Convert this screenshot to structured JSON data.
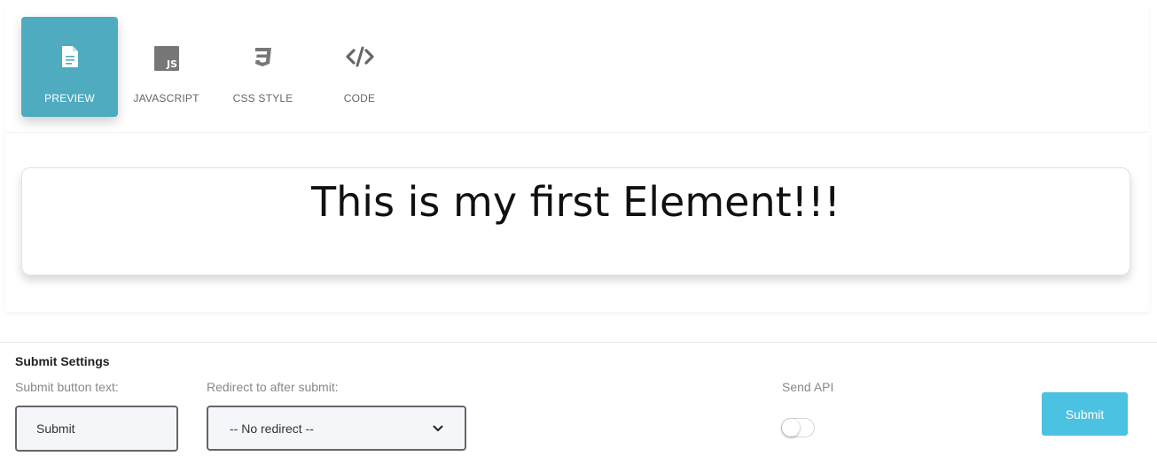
{
  "tabs": [
    {
      "label": "PREVIEW",
      "icon": "file-icon",
      "active": true
    },
    {
      "label": "JAVASCRIPT",
      "icon": "js-icon",
      "active": false
    },
    {
      "label": "CSS STYLE",
      "icon": "css3-icon",
      "active": false
    },
    {
      "label": "CODE",
      "icon": "code-icon",
      "active": false
    }
  ],
  "preview": {
    "text": "This is my first Element!!!"
  },
  "settings": {
    "title": "Submit Settings",
    "submit_text_label": "Submit button text:",
    "submit_text_value": "Submit",
    "redirect_label": "Redirect to after submit:",
    "redirect_value": "-- No redirect --",
    "send_api_label": "Send API",
    "send_api_enabled": false,
    "submit_button": "Submit"
  },
  "colors": {
    "active_tab": "#4eabc0",
    "submit_button": "#4cc2e2"
  }
}
